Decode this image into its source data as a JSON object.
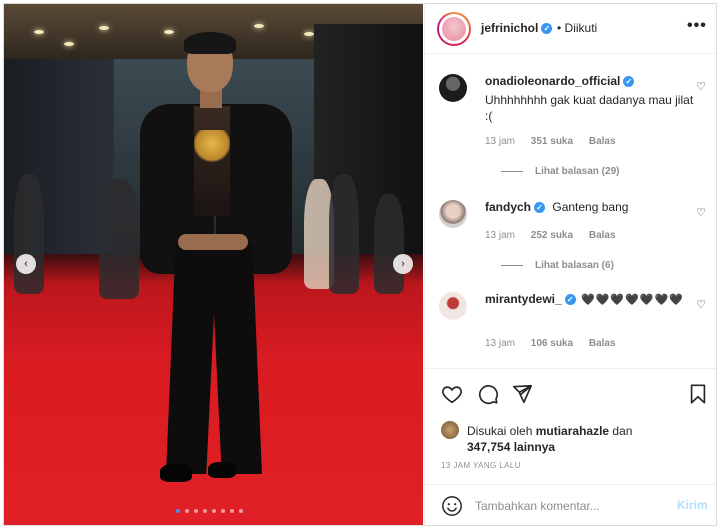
{
  "post": {
    "username": "jefrinichol",
    "follow_status": "Diikuti",
    "separator": "•",
    "more": "•••"
  },
  "comments": [
    {
      "username": "onadioleonardo_official",
      "verified": true,
      "text": "Uhhhhhhhh gak kuat dadanya mau jilat :(",
      "time": "13 jam",
      "likes": "351 suka",
      "reply": "Balas",
      "replies": "Lihat balasan (29)"
    },
    {
      "username": "fandych",
      "verified": true,
      "text": "Ganteng bang",
      "time": "13 jam",
      "likes": "252 suka",
      "reply": "Balas",
      "replies": "Lihat balasan (6)"
    },
    {
      "username": "mirantydewi_",
      "verified": true,
      "text": "🖤🖤🖤🖤🖤🖤🖤",
      "time": "13 jam",
      "likes": "106 suka",
      "reply": "Balas"
    }
  ],
  "likes": {
    "prefix": "Disukai oleh",
    "user": "mutiarahazle",
    "conj": "dan",
    "count": "347,754 lainnya"
  },
  "time_ago": "13 JAM YANG LALU",
  "add_comment": {
    "placeholder": "Tambahkan komentar...",
    "send": "Kirim"
  },
  "carousel": {
    "prev": "‹",
    "next": "›",
    "total_slides": 8,
    "active_slide": 1
  },
  "colors": {
    "verified": "#3897f0",
    "send_disabled": "#b2dffc",
    "carpet": "#d91c22"
  }
}
